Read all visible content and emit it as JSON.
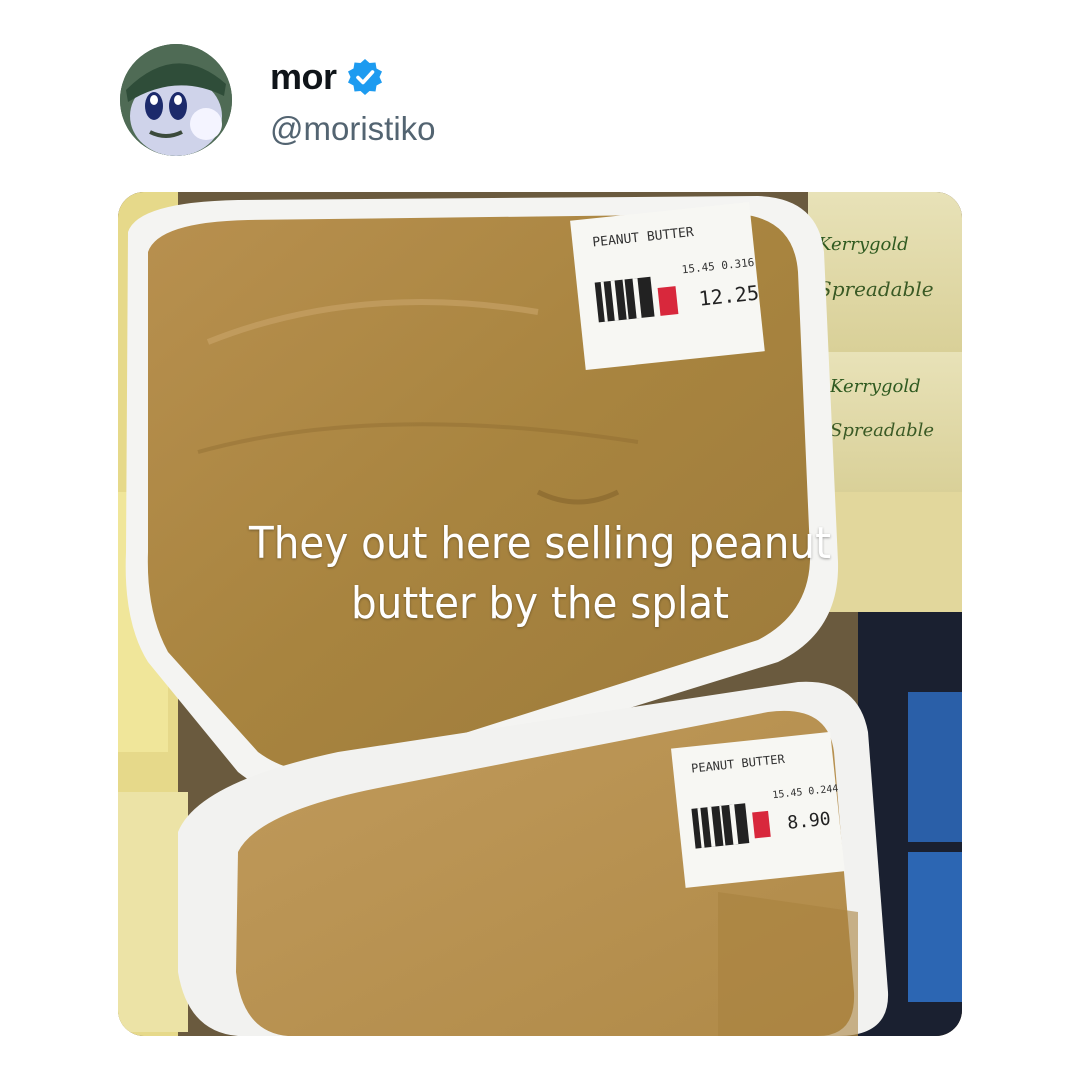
{
  "post": {
    "author": {
      "display_name": "mor",
      "handle": "@moristiko",
      "verified": true,
      "verified_icon": "verified-badge-icon",
      "verified_color": "#1d9bf0"
    },
    "media": {
      "caption_lines": [
        "They out here selling peanut",
        "butter by the splat"
      ],
      "labels": [
        {
          "title": "PEANUT BUTTER",
          "price": "12.25",
          "unit_price": "15.45",
          "weight": "0.316"
        },
        {
          "title": "PEANUT BUTTER",
          "price": "8.90",
          "unit_price": "15.45",
          "weight": "0.244"
        }
      ],
      "brand_text": [
        "Kerrygold",
        "Spreadable"
      ]
    }
  }
}
